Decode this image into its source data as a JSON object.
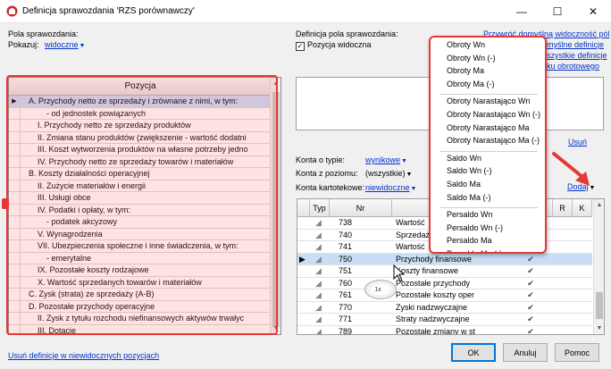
{
  "window": {
    "title": "Definicja sprawozdania 'RZS porównawczy'",
    "minimize": "—",
    "maximize": "☐",
    "close": "✕"
  },
  "left": {
    "fields_label": "Pola sprawozdania:",
    "show_label": "Pokazuj:",
    "show_value": "widoczne",
    "column_header": "Pozycja",
    "rows": [
      {
        "text": "A. Przychody netto ze sprzedaży i zrównane z nimi, w tym:",
        "indent": 0,
        "selected": true
      },
      {
        "text": "- od jednostek powiązanych",
        "indent": 2,
        "selected": false
      },
      {
        "text": "I. Przychody netto ze sprzedaży produktów",
        "indent": 1,
        "selected": false
      },
      {
        "text": "II. Zmiana stanu produktów (zwiększenie - wartość dodatni",
        "indent": 1,
        "selected": false
      },
      {
        "text": "III. Koszt wytworzenia produktów na własne potrzeby jedno",
        "indent": 1,
        "selected": false
      },
      {
        "text": "IV. Przychody netto ze sprzedaży towarów i materiałów",
        "indent": 1,
        "selected": false
      },
      {
        "text": "B. Koszty działalności operacyjnej",
        "indent": 0,
        "selected": false
      },
      {
        "text": "II. Zużycie materiałów i energii",
        "indent": 1,
        "selected": false
      },
      {
        "text": "III. Usługi obce",
        "indent": 1,
        "selected": false
      },
      {
        "text": "IV. Podatki i opłaty, w tym:",
        "indent": 1,
        "selected": false
      },
      {
        "text": "- podatek akcyzowy",
        "indent": 2,
        "selected": false
      },
      {
        "text": "V. Wynagrodzenia",
        "indent": 1,
        "selected": false
      },
      {
        "text": "VII. Ubezpieczenia społeczne i inne świadczenia, w tym:",
        "indent": 1,
        "selected": false
      },
      {
        "text": "- emerytalne",
        "indent": 2,
        "selected": false
      },
      {
        "text": "IX. Pozostałe koszty rodzajowe",
        "indent": 1,
        "selected": false
      },
      {
        "text": "X. Wartość sprzedanych towarów i materiałów",
        "indent": 1,
        "selected": false
      },
      {
        "text": "C. Zysk (strata) ze sprzedaży (A-B)",
        "indent": 0,
        "selected": false
      },
      {
        "text": "D. Pozostałe przychody operacyjne",
        "indent": 0,
        "selected": false
      },
      {
        "text": "II. Zysk z tytułu rozchodu niefinansowych aktywów trwałyc",
        "indent": 1,
        "selected": false
      },
      {
        "text": "III. Dotacje",
        "indent": 1,
        "selected": false
      }
    ]
  },
  "right": {
    "def_label": "Definicja pola sprawozdania:",
    "visible_label": "Pozycja widoczna",
    "link_restore": "Przywróć domyślną widoczność pól",
    "link_default_defs_partial": "myślne definicje",
    "link_all_defs_partial": "szystkie definicje",
    "link_period_partial": "ku obrotowego",
    "delete_link": "Usuń",
    "add_link": "Dodaj",
    "account_type_label": "Konta o typie:",
    "account_type_value": "wynikowe",
    "account_level_label": "Konta z poziomu:",
    "account_level_value": "(wszystkie)",
    "card_accounts_label": "Konta kartotekowe:",
    "card_accounts_value": "niewidoczne"
  },
  "grid": {
    "headers": {
      "typ": "Typ",
      "nr": "Nr",
      "r": "R",
      "k": "K"
    },
    "rows": [
      {
        "nr": "738",
        "name": "Wartość",
        "check": false,
        "selected": false
      },
      {
        "nr": "740",
        "name": "Sprzedaż",
        "check": false,
        "selected": false
      },
      {
        "nr": "741",
        "name": "Wartość",
        "check": false,
        "selected": false
      },
      {
        "nr": "750",
        "name": "Przychody finansowe",
        "check": true,
        "selected": true
      },
      {
        "nr": "751",
        "name": "Koszty finansowe",
        "check": true,
        "selected": false
      },
      {
        "nr": "760",
        "name": "Pozostałe przychody",
        "check": true,
        "selected": false
      },
      {
        "nr": "761",
        "name": "Pozostałe koszty oper",
        "check": true,
        "selected": false
      },
      {
        "nr": "770",
        "name": "Zyski nadzwyczajne",
        "check": true,
        "selected": false
      },
      {
        "nr": "771",
        "name": "Straty nadzwyczajne",
        "check": true,
        "selected": false
      },
      {
        "nr": "789",
        "name": "Pozostałe zmiany w st",
        "check": true,
        "selected": false
      }
    ],
    "check_glyph": "✔",
    "type_glyph": "◢"
  },
  "cursor_badge": "1x",
  "menu": {
    "groups": [
      [
        "Obroty Wn",
        "Obroty Wn (-)",
        "Obroty Ma",
        "Obroty Ma (-)"
      ],
      [
        "Obroty Narastająco Wn",
        "Obroty Narastająco Wn (-)",
        "Obroty Narastająco Ma",
        "Obroty Narastająco Ma (-)"
      ],
      [
        "Saldo Wn",
        "Saldo Wn (-)",
        "Saldo Ma",
        "Saldo Ma (-)"
      ],
      [
        "Persaldo Wn",
        "Persaldo Wn (-)",
        "Persaldo Ma",
        "Persaldo Ma (-)"
      ]
    ]
  },
  "footer": {
    "remove_hidden_link": "Usuń definicje w niewidocznych pozycjach",
    "ok": "OK",
    "cancel": "Anuluj",
    "help": "Pomoc"
  },
  "colors": {
    "highlight_red": "#e53935",
    "link_blue": "#0033cc",
    "selection": "#c7def5"
  }
}
